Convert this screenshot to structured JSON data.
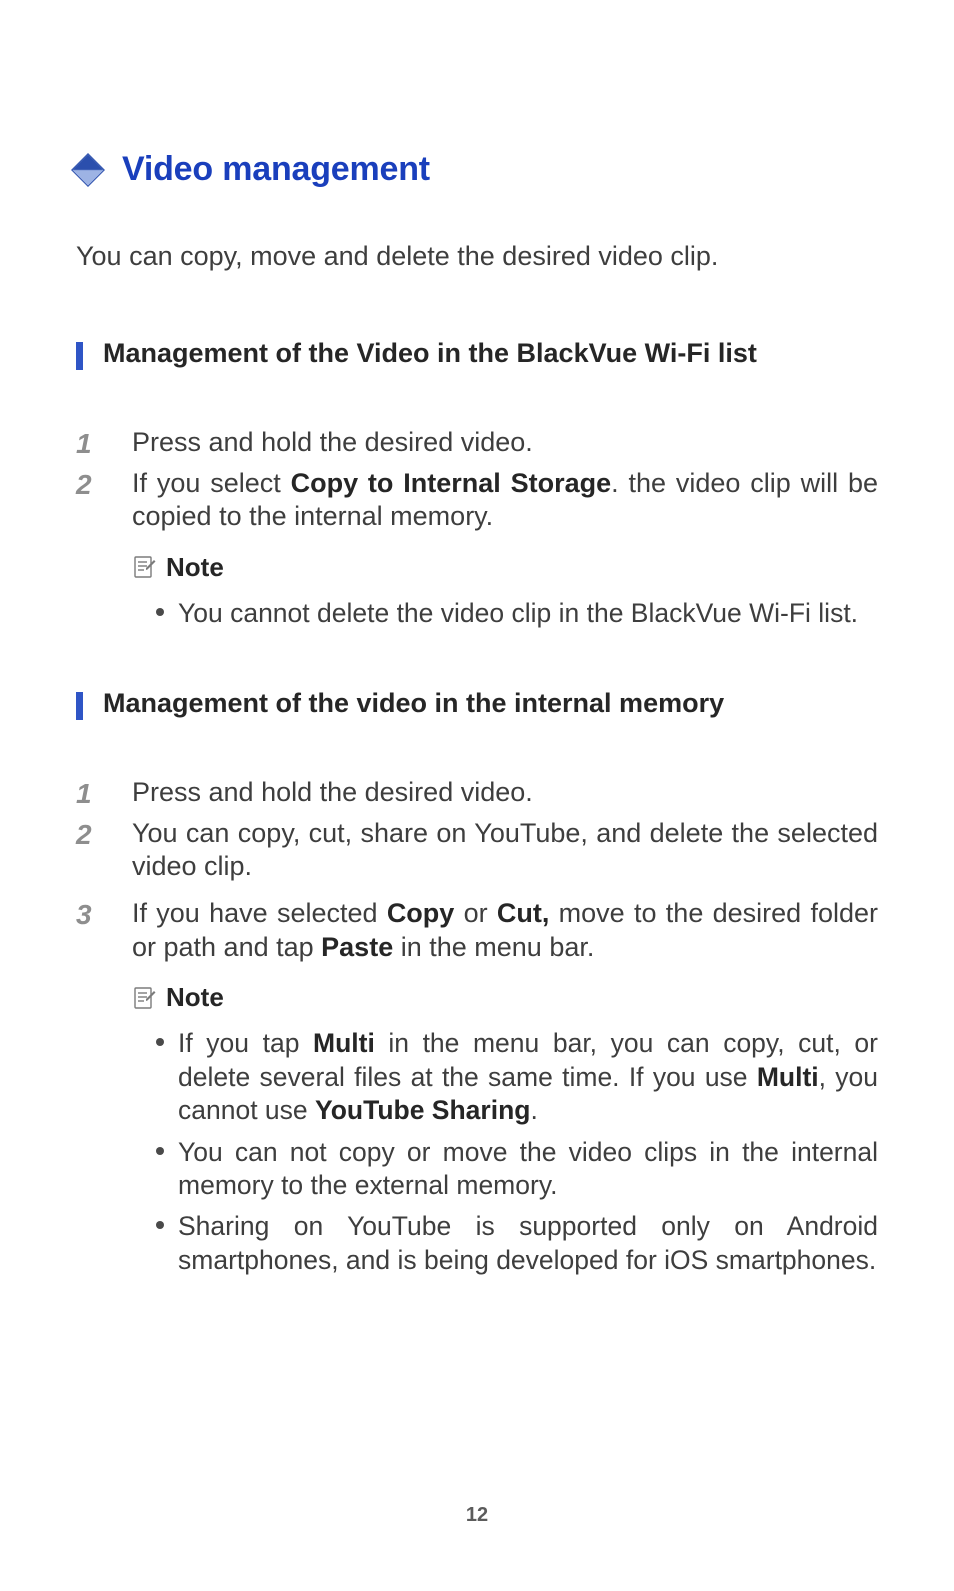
{
  "heading": "Video management",
  "intro": "You can copy, move and delete the desired video clip.",
  "sections": [
    {
      "subhead": "Management of the Video in the BlackVue Wi-Fi list",
      "steps": [
        {
          "html": "Press and hold the desired video."
        },
        {
          "html": "If you select <span class=\"b\">Copy to Internal Storage</span>. the video clip will be copied to the internal memory."
        }
      ],
      "note": {
        "label": "Note",
        "items": [
          {
            "html": "You cannot delete the video clip in the BlackVue Wi-Fi list."
          }
        ]
      }
    },
    {
      "subhead": "Management of the video in the internal memory",
      "steps": [
        {
          "html": "Press and hold the desired video."
        },
        {
          "html": "You can copy, cut, share on YouTube, and delete the selected video clip."
        },
        {
          "html": "If you have selected <span class=\"b\">Copy</span> or <span class=\"b\">Cut,</span> move to the desired folder or path and tap <span class=\"b\">Paste</span> in the menu bar."
        }
      ],
      "note": {
        "label": "Note",
        "items": [
          {
            "html": "If you tap <span class=\"b\">Multi</span> in the menu bar, you can copy, cut, or delete several files at the same time. If you use <span class=\"b\">Multi</span>, you cannot use <span class=\"b\">YouTube Sharing</span>."
          },
          {
            "html": "You can not copy or move the video clips in the internal memory to the external memory."
          },
          {
            "html": "Sharing on YouTube is supported only on Android smartphones, and is being developed for iOS smartphones."
          }
        ]
      }
    }
  ],
  "page_number": "12"
}
